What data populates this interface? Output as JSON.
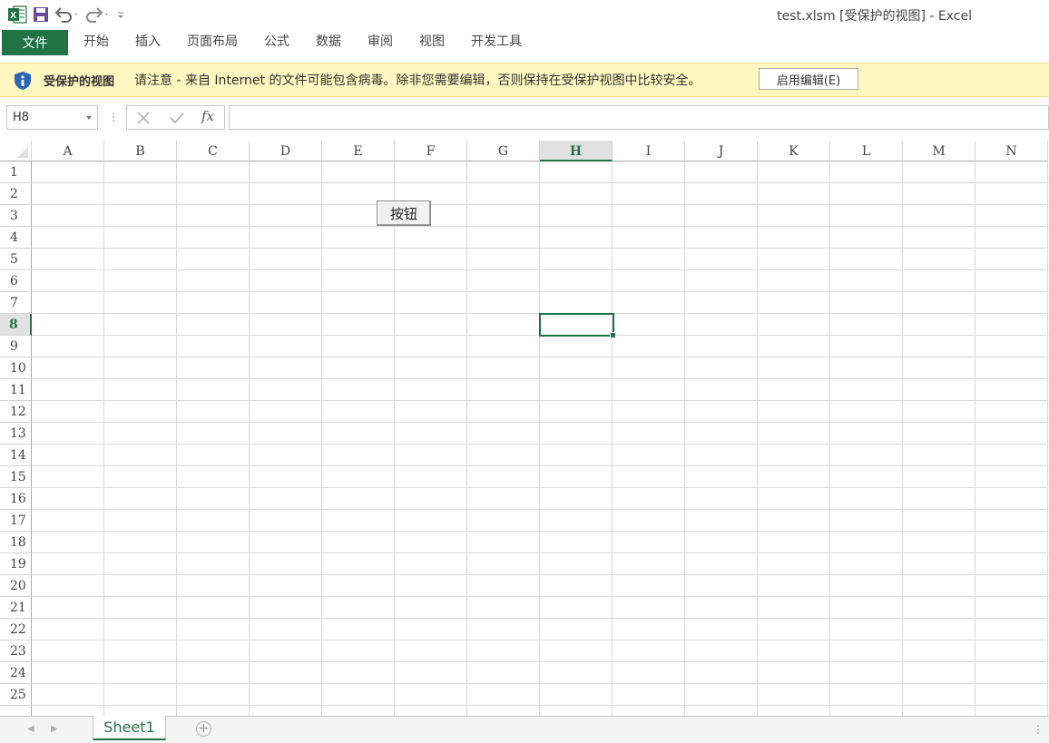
{
  "window": {
    "title": "test.xlsm  [受保护的视图] - Excel"
  },
  "quick_access": {
    "items": [
      "excel-logo-icon",
      "save-icon",
      "undo-icon",
      "redo-icon",
      "customize-icon"
    ]
  },
  "ribbon": {
    "file_label": "文件",
    "tabs": [
      "开始",
      "插入",
      "页面布局",
      "公式",
      "数据",
      "审阅",
      "视图",
      "开发工具"
    ]
  },
  "protected_view": {
    "title": "受保护的视图",
    "message": "请注意 - 来自 Internet 的文件可能包含病毒。除非您需要编辑，否则保持在受保护视图中比较安全。",
    "enable_button": "启用编辑(E)"
  },
  "formula_bar": {
    "name_box": "H8",
    "cancel_icon": "x-icon",
    "enter_icon": "check-icon",
    "fx_label": "fx",
    "formula_value": ""
  },
  "sheet": {
    "columns": [
      "A",
      "B",
      "C",
      "D",
      "E",
      "F",
      "G",
      "H",
      "I",
      "J",
      "K",
      "L",
      "M",
      "N"
    ],
    "rows": [
      "1",
      "2",
      "3",
      "4",
      "5",
      "6",
      "7",
      "8",
      "9",
      "10",
      "11",
      "12",
      "13",
      "14",
      "15",
      "16",
      "17",
      "18",
      "19",
      "20",
      "21",
      "22",
      "23",
      "24",
      "25"
    ],
    "selected_cell": "H8",
    "selected_column": "H",
    "selected_row": "8",
    "form_button_label": "按钮"
  },
  "sheet_tabs": {
    "tabs": [
      "Sheet1"
    ],
    "active": "Sheet1",
    "add_label": "+"
  },
  "colors": {
    "accent": "#217346",
    "protected_bar": "#fff7bf"
  }
}
